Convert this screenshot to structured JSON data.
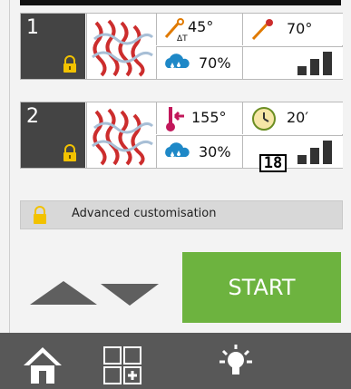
{
  "programs": [
    {
      "number": "1",
      "temp_main": "45°",
      "temp_sub": "ΔT",
      "humidity": "70%",
      "probe_temp": "70°",
      "power_level": 3
    },
    {
      "number": "2",
      "temp_main": "155°",
      "humidity": "30%",
      "time": "20′",
      "level_badge": "18",
      "power_level": 3
    }
  ],
  "advanced": {
    "label": "Advanced customisation"
  },
  "start": {
    "label": "START"
  },
  "colors": {
    "start_green": "#6db33f",
    "dark_panel": "#444444",
    "bottom_bar": "#585858",
    "lock_yellow": "#f2c200",
    "arrow_gray": "#5f5f5f"
  }
}
